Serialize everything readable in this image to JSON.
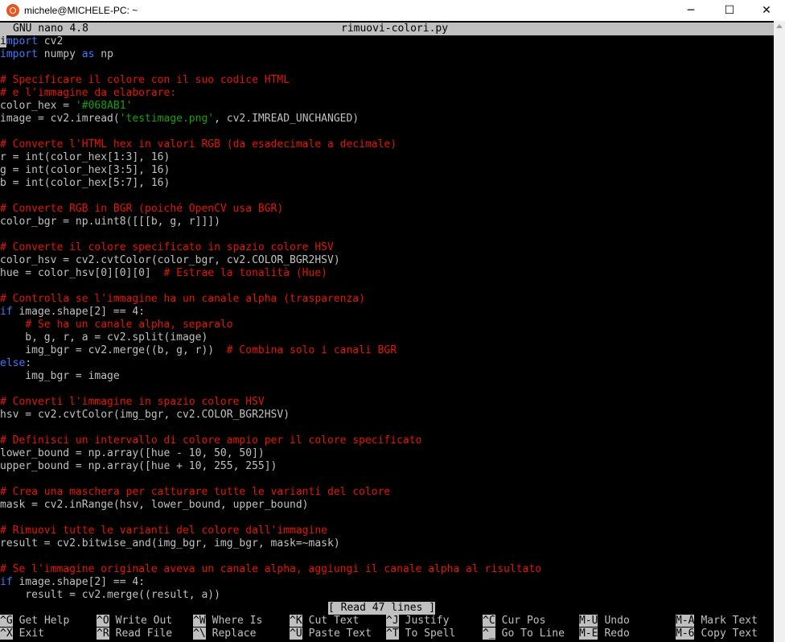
{
  "window": {
    "title": "michele@MICHELE-PC: ~",
    "minimize": "─",
    "maximize": "☐",
    "close": "✕"
  },
  "nano": {
    "version": "GNU nano 4.8",
    "filename": "rimuovi-colori.py",
    "status": "[ Read 47 lines ]"
  },
  "code": [
    [
      {
        "t": "i",
        "c": "cursor"
      },
      {
        "t": "mport",
        "c": "kw"
      },
      {
        "t": " cv2"
      }
    ],
    [
      {
        "t": "import",
        "c": "kw"
      },
      {
        "t": " numpy "
      },
      {
        "t": "as",
        "c": "kw"
      },
      {
        "t": " np"
      }
    ],
    [],
    [
      {
        "t": "# Specificare il colore con il suo codice HTML",
        "c": "cm"
      }
    ],
    [
      {
        "t": "# e l'immagine da elaborare:",
        "c": "cm"
      }
    ],
    [
      {
        "t": "color_hex = "
      },
      {
        "t": "'#068AB1'",
        "c": "st"
      }
    ],
    [
      {
        "t": "image = cv2.imread("
      },
      {
        "t": "'testimage.png'",
        "c": "st"
      },
      {
        "t": ", cv2.IMREAD_UNCHANGED)"
      }
    ],
    [],
    [
      {
        "t": "# Converte l'HTML hex in valori RGB (da esadecimale a decimale)",
        "c": "cm"
      }
    ],
    [
      {
        "t": "r = int(color_hex[1:3], 16)"
      }
    ],
    [
      {
        "t": "g = int(color_hex[3:5], 16)"
      }
    ],
    [
      {
        "t": "b = int(color_hex[5:7], 16)"
      }
    ],
    [],
    [
      {
        "t": "# Converte RGB in BGR (poiché OpenCV usa BGR)",
        "c": "cm"
      }
    ],
    [
      {
        "t": "color_bgr = np.uint8([[[b, g, r]]])"
      }
    ],
    [],
    [
      {
        "t": "# Converte il colore specificato in spazio colore HSV",
        "c": "cm"
      }
    ],
    [
      {
        "t": "color_hsv = cv2.cvtColor(color_bgr, cv2.COLOR_BGR2HSV)"
      }
    ],
    [
      {
        "t": "hue = color_hsv[0][0][0]  "
      },
      {
        "t": "# Estrae la tonalità (Hue)",
        "c": "cm"
      }
    ],
    [],
    [
      {
        "t": "# Controlla se l'immagine ha un canale alpha (trasparenza)",
        "c": "cm"
      }
    ],
    [
      {
        "t": "if",
        "c": "kw"
      },
      {
        "t": " image.shape[2] == 4:"
      }
    ],
    [
      {
        "t": "    "
      },
      {
        "t": "# Se ha un canale alpha, separalo",
        "c": "cm"
      }
    ],
    [
      {
        "t": "    b, g, r, a = cv2.split(image)"
      }
    ],
    [
      {
        "t": "    img_bgr = cv2.merge((b, g, r))  "
      },
      {
        "t": "# Combina solo i canali BGR",
        "c": "cm"
      }
    ],
    [
      {
        "t": "else",
        "c": "kw"
      },
      {
        "t": ":"
      }
    ],
    [
      {
        "t": "    img_bgr = image"
      }
    ],
    [],
    [
      {
        "t": "# Converti l'immagine in spazio colore HSV",
        "c": "cm"
      }
    ],
    [
      {
        "t": "hsv = cv2.cvtColor(img_bgr, cv2.COLOR_BGR2HSV)"
      }
    ],
    [],
    [
      {
        "t": "# Definisci un intervallo di colore ampio per il colore specificato",
        "c": "cm"
      }
    ],
    [
      {
        "t": "lower_bound = np.array([hue - 10, 50, 50])"
      }
    ],
    [
      {
        "t": "upper_bound = np.array([hue + 10, 255, 255])"
      }
    ],
    [],
    [
      {
        "t": "# Crea una maschera per catturare tutte le varianti del colore",
        "c": "cm"
      }
    ],
    [
      {
        "t": "mask = cv2.inRange(hsv, lower_bound, upper_bound)"
      }
    ],
    [],
    [
      {
        "t": "# Rimuovi tutte le varianti del colore dall'immagine",
        "c": "cm"
      }
    ],
    [
      {
        "t": "result = cv2.bitwise_and(img_bgr, img_bgr, mask=~mask)"
      }
    ],
    [],
    [
      {
        "t": "# Se l'immagine originale aveva un canale alpha, aggiungi il canale alpha al risultato",
        "c": "cm"
      }
    ],
    [
      {
        "t": "if",
        "c": "kw"
      },
      {
        "t": " image.shape[2] == 4:"
      }
    ],
    [
      {
        "t": "    result = cv2.merge((result, a))"
      }
    ]
  ],
  "shortcuts": [
    [
      {
        "key": "^G",
        "label": "Get Help"
      },
      {
        "key": "^O",
        "label": "Write Out"
      },
      {
        "key": "^W",
        "label": "Where Is"
      },
      {
        "key": "^K",
        "label": "Cut Text"
      },
      {
        "key": "^J",
        "label": "Justify"
      },
      {
        "key": "^C",
        "label": "Cur Pos"
      },
      {
        "key": "M-U",
        "label": "Undo"
      },
      {
        "key": "M-A",
        "label": "Mark Text"
      }
    ],
    [
      {
        "key": "^X",
        "label": "Exit"
      },
      {
        "key": "^R",
        "label": "Read File"
      },
      {
        "key": "^\\",
        "label": "Replace"
      },
      {
        "key": "^U",
        "label": "Paste Text"
      },
      {
        "key": "^T",
        "label": "To Spell"
      },
      {
        "key": "^_",
        "label": "Go To Line"
      },
      {
        "key": "M-E",
        "label": "Redo"
      },
      {
        "key": "M-6",
        "label": "Copy Text"
      }
    ]
  ]
}
